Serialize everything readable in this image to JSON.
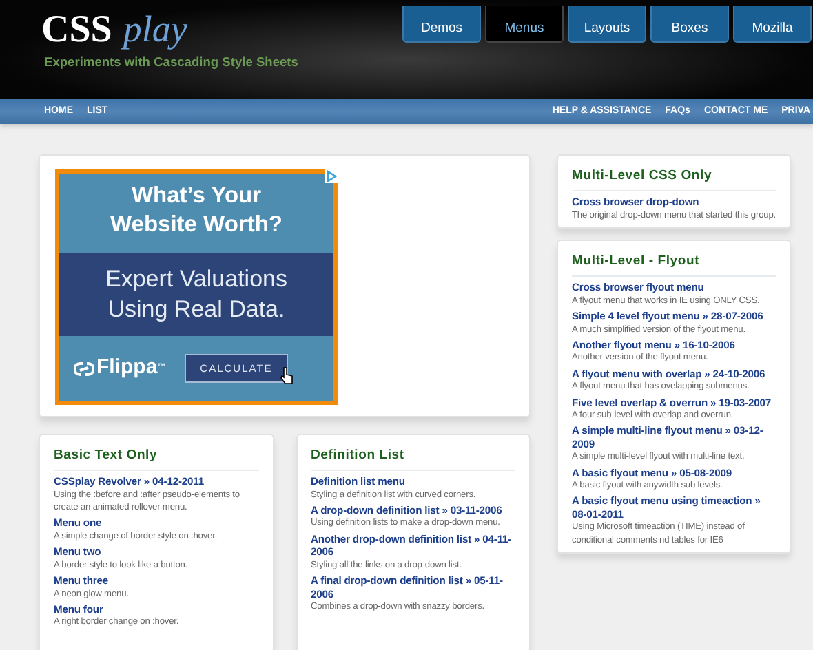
{
  "header": {
    "logo_main": "CSS",
    "logo_script": "play",
    "tagline": "Experiments with Cascading Style Sheets",
    "tabs": [
      {
        "label": "Demos",
        "selected": false
      },
      {
        "label": "Menus",
        "selected": true
      },
      {
        "label": "Layouts",
        "selected": false
      },
      {
        "label": "Boxes",
        "selected": false
      },
      {
        "label": "Mozilla",
        "selected": false
      }
    ]
  },
  "nav": {
    "left": [
      "HOME",
      "LIST"
    ],
    "right": [
      "HELP & ASSISTANCE",
      "FAQs",
      "CONTACT ME",
      "PRIVA"
    ]
  },
  "ad": {
    "headline": "What’s Your Website Worth?",
    "subline": "Expert Valuations Using Real Data.",
    "brand": "Flippa",
    "brand_mark": "™",
    "button": "CALCULATE"
  },
  "main_panels": [
    {
      "title": "Basic Text Only",
      "items": [
        {
          "link": "CSSplay Revolver » 04-12-2011",
          "description": "Using the :before and :after pseudo-elements to create an animated rollover menu."
        },
        {
          "link": "Menu one",
          "description": "A simple change of border style on :hover."
        },
        {
          "link": "Menu two",
          "description": "A border style to look like a button."
        },
        {
          "link": "Menu three",
          "description": "A neon glow menu."
        },
        {
          "link": "Menu four",
          "description": "A right border change on :hover."
        }
      ]
    },
    {
      "title": "Definition List",
      "items": [
        {
          "link": "Definition list menu",
          "description": "Styling a definition list with curved corners."
        },
        {
          "link": "A drop-down definition list » 03-11-2006",
          "description": "Using definition lists to make a drop-down menu."
        },
        {
          "link": "Another drop-down definition list » 04-11-2006",
          "description": "Styling all the links on a drop-down list."
        },
        {
          "link": "A final drop-down definition list » 05-11-2006",
          "description": "Combines a drop-down with snazzy borders."
        }
      ]
    }
  ],
  "side_panels": [
    {
      "title": "Multi-Level CSS Only",
      "items": [
        {
          "link": "Cross browser drop-down",
          "description": "The original drop-down menu that started this group."
        }
      ]
    },
    {
      "title": "Multi-Level - Flyout",
      "items": [
        {
          "link": "Cross browser flyout menu",
          "description": "A flyout menu that works in IE using ONLY CSS."
        },
        {
          "link": "Simple 4 level flyout menu » 28-07-2006",
          "description": "A much simplified version of the flyout menu."
        },
        {
          "link": "Another flyout menu » 16-10-2006",
          "description": "Another version of the flyout menu."
        },
        {
          "link": "A flyout menu with overlap » 24-10-2006",
          "description": "A flyout menu that has ovelapping submenus."
        },
        {
          "link": "Five level overlap & overrun » 19-03-2007",
          "description": "A four sub-level with overlap and overrun."
        },
        {
          "link": "A simple multi-line flyout menu » 03-12-2009",
          "description": "A simple multi-level flyout with multi-line text."
        },
        {
          "link": "A basic flyout menu » 05-08-2009",
          "description": "A basic flyout with anywidth sub levels."
        },
        {
          "link": "A basic flyout menu using timeaction » 08-01-2011",
          "description": "Using Microsoft timeaction (TIME) instead of conditional comments nd tables for IE6"
        }
      ]
    }
  ]
}
